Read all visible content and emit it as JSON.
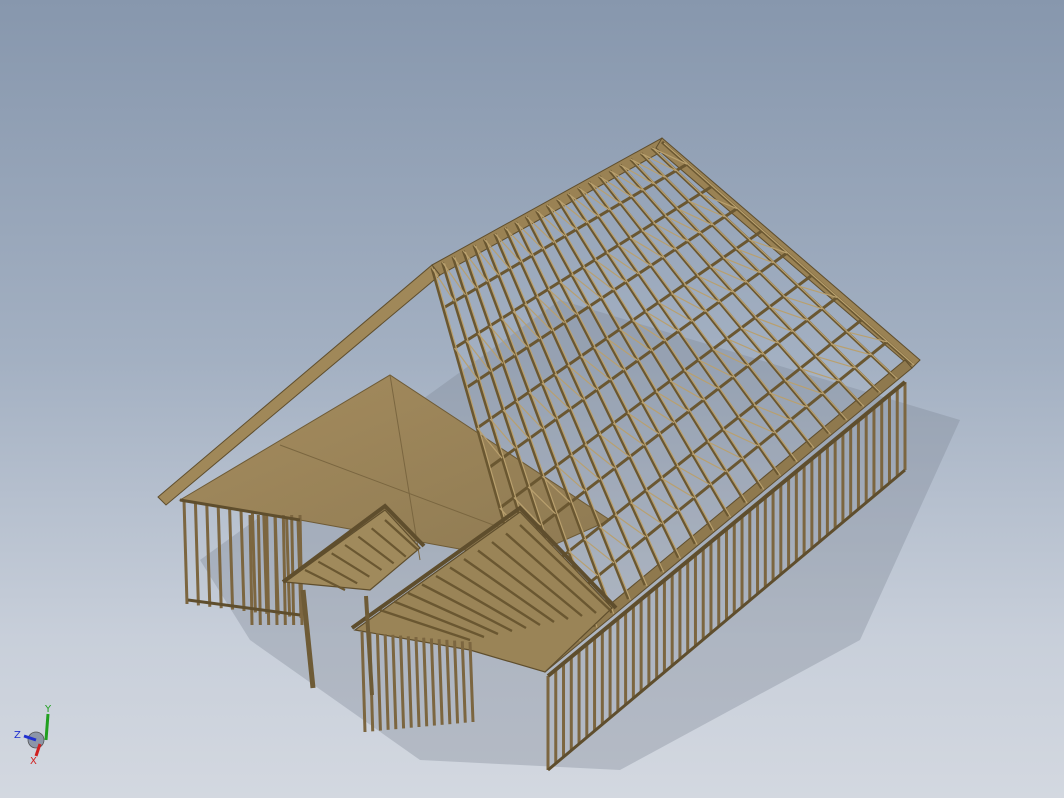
{
  "viewport": {
    "model": "house-framing-model",
    "colors": {
      "background_top": "#8797ad",
      "background_bottom": "#d3d8e0",
      "wood": "#9c8458",
      "wood_dark": "#6e5b36",
      "wood_light": "#b09768",
      "shadow": "#7d8696"
    }
  },
  "triad": {
    "x_label": "X",
    "y_label": "Y",
    "z_label": "Z",
    "x_color": "#d02020",
    "y_color": "#20a020",
    "z_color": "#2030d0"
  }
}
